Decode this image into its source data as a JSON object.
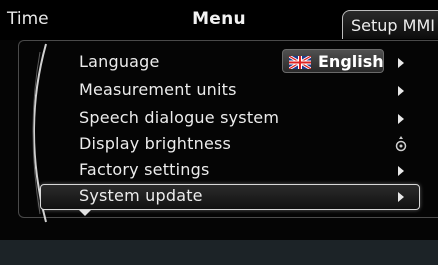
{
  "header": {
    "left_label": "Time",
    "title": "Menu",
    "tab_label": "Setup MMI"
  },
  "menu": {
    "items": [
      {
        "label": "Language",
        "value": "English",
        "value_icon": "uk-flag-icon",
        "indicator": "arrow-right-icon"
      },
      {
        "label": "Measurement units",
        "indicator": "arrow-right-icon"
      },
      {
        "label": "Speech dialogue system",
        "indicator": "arrow-right-icon"
      },
      {
        "label": "Display brightness",
        "indicator": "rotary-knob-icon"
      },
      {
        "label": "Factory settings",
        "indicator": "arrow-right-icon"
      },
      {
        "label": "System update",
        "indicator": "arrow-right-icon",
        "selected": true
      }
    ],
    "more_below_icon": "scroll-down-icon"
  },
  "colors": {
    "background": "#050505",
    "text": "#ececec",
    "bottom_bar": "#1c2327",
    "selection_border": "#d8d8d8"
  }
}
